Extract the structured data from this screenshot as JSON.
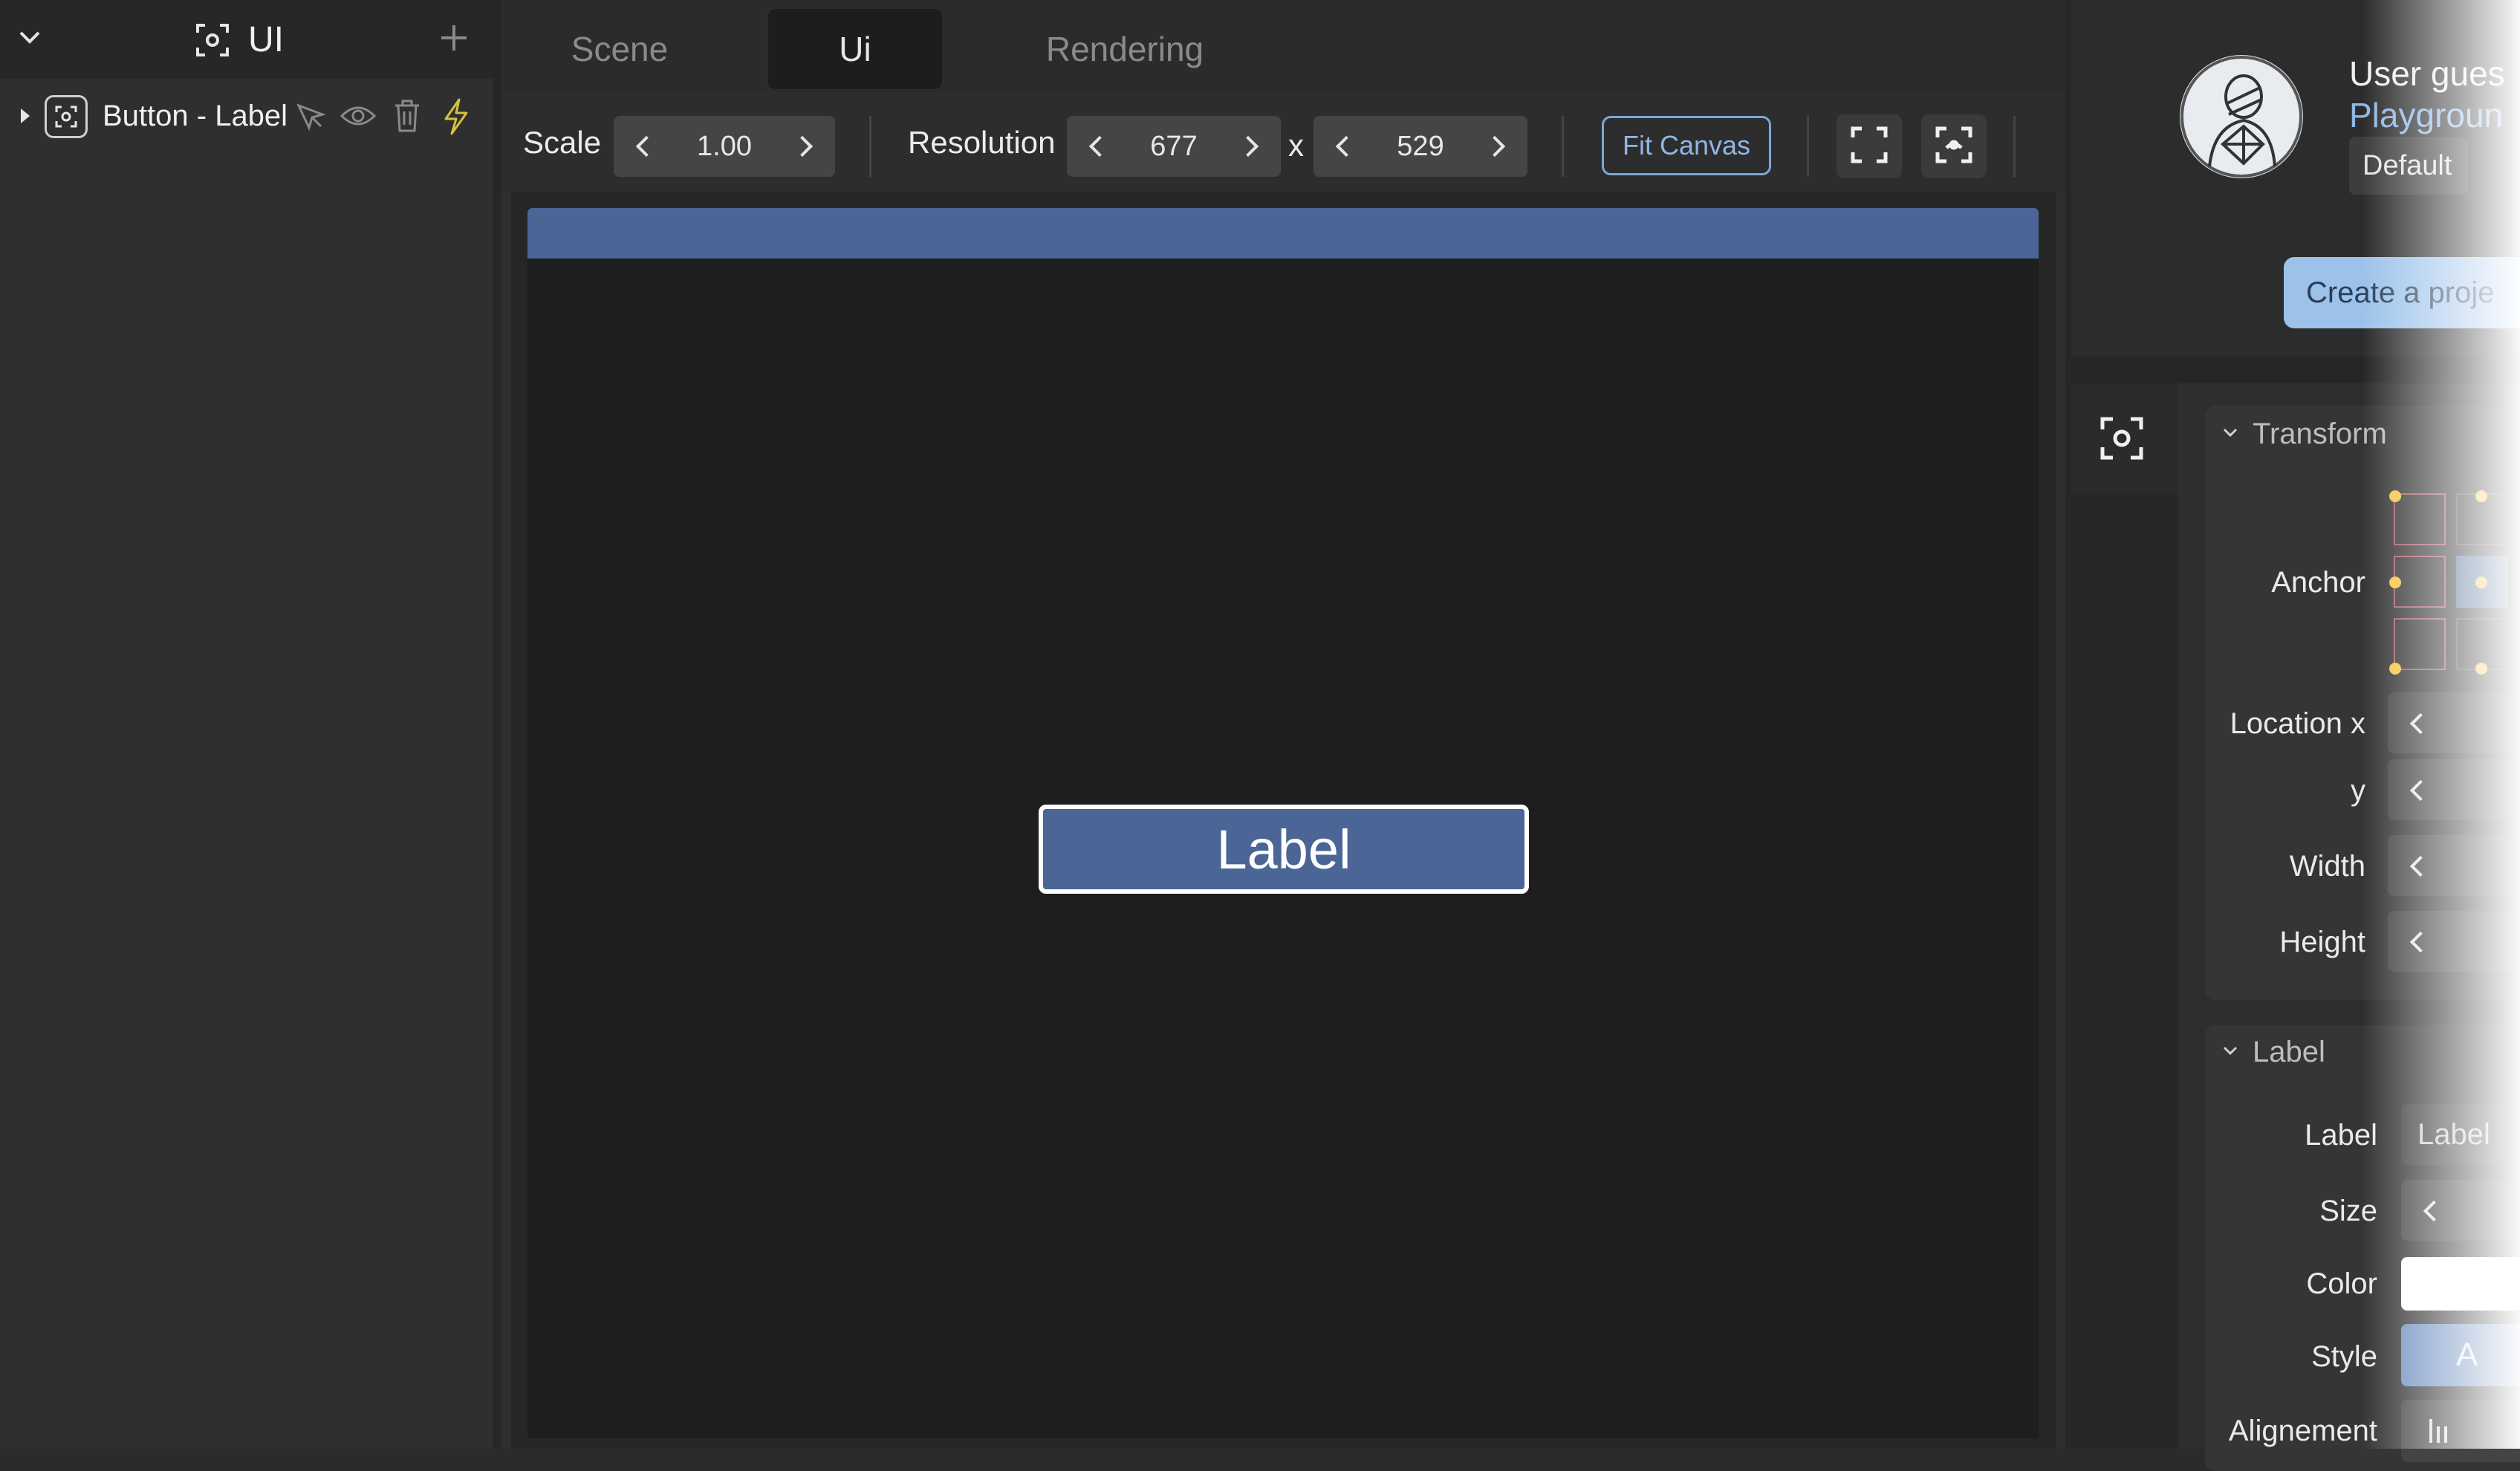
{
  "left_panel": {
    "title": "UI",
    "tree_items": [
      {
        "label": "Button - Label"
      }
    ]
  },
  "tabs": [
    {
      "label": "Scene",
      "active": false
    },
    {
      "label": "Ui",
      "active": true
    },
    {
      "label": "Rendering",
      "active": false
    }
  ],
  "toolbar": {
    "scale_label": "Scale",
    "scale_value": "1.00",
    "resolution_label": "Resolution",
    "resolution_width": "677",
    "times_symbol": "x",
    "resolution_height": "529",
    "fit_canvas_label": "Fit Canvas"
  },
  "canvas": {
    "button_label": "Label"
  },
  "user": {
    "name": "User gues",
    "project": "Playgroun",
    "badge": "Default",
    "create_project_label": "Create a proje"
  },
  "transform": {
    "title": "Transform",
    "anchor_label": "Anchor",
    "location_x_label": "Location x",
    "y_label": "y",
    "width_label": "Width",
    "height_label": "Height"
  },
  "label_section": {
    "title": "Label",
    "label_label": "Label",
    "label_value": "Label",
    "size_label": "Size",
    "color_label": "Color",
    "style_label": "Style",
    "style_value": "A",
    "alignment_label": "Alignement"
  },
  "colors": {
    "accent": "#4a6596",
    "fit_canvas_border": "#7aa7d8",
    "link": "#8fb6e6",
    "lightning": "#d9c13a",
    "anchor_dot": "#f5c542"
  }
}
